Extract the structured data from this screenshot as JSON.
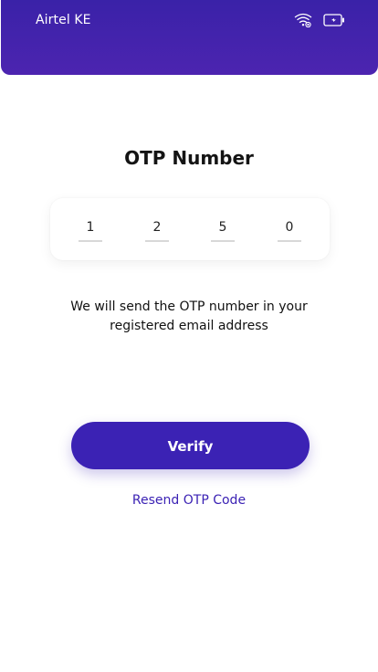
{
  "status_bar": {
    "carrier": "Airtel KE",
    "icons": [
      "wifi-icon",
      "battery-icon"
    ]
  },
  "title": "OTP Number",
  "otp": {
    "digits": [
      "1",
      "2",
      "5",
      "0"
    ]
  },
  "helper_text": "We will send the OTP number in your registered email address",
  "verify_label": "Verify",
  "resend_label": "Resend OTP Code",
  "colors": {
    "primary": "#3b22b4",
    "header": "#4224ab",
    "text": "#111111",
    "underline": "#d8d8d8"
  }
}
